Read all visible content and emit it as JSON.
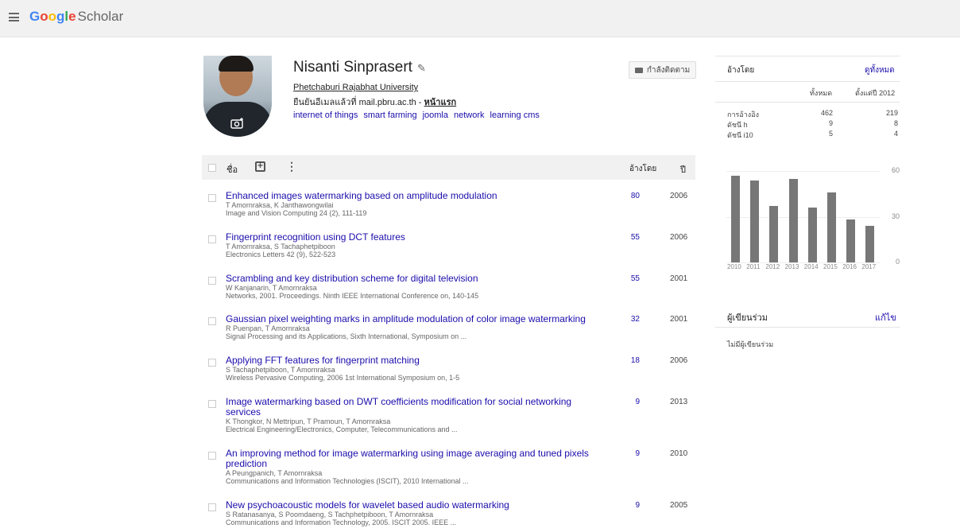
{
  "header": {
    "logo_word": "Google",
    "logo_colors": [
      "#4285F4",
      "#EA4335",
      "#FBBC05",
      "#4285F4",
      "#34A853",
      "#EA4335"
    ],
    "logo_suffix": "Scholar",
    "menu_icon": "hamburger-menu-icon"
  },
  "profile": {
    "name": "Nisanti Sinprasert",
    "affiliation": "Phetchaburi Rajabhat University",
    "verified_text": "ยืนยันอีเมลแล้วที่ mail.pbru.ac.th - ",
    "homepage_label": "หน้าแรก",
    "interests": [
      "internet of things",
      "smart farming",
      "joomla",
      "network",
      "learning cms"
    ],
    "follow_label": "กำลังติดตาม",
    "camera_icon": "camera-icon",
    "edit_icon": "pencil-icon"
  },
  "table": {
    "title_header": "ชื่อ",
    "cited_header": "อ้างโดย",
    "year_header": "ปี"
  },
  "articles": [
    {
      "title": "Enhanced images watermarking based on amplitude modulation",
      "authors": "T Amornraksa, K Janthawongwilai",
      "venue": "Image and Vision Computing 24 (2), 111-119",
      "cited": "80",
      "year": "2006"
    },
    {
      "title": "Fingerprint recognition using DCT features",
      "authors": "T Amornraksa, S Tachaphetpiboon",
      "venue": "Electronics Letters 42 (9), 522-523",
      "cited": "55",
      "year": "2006"
    },
    {
      "title": "Scrambling and key distribution scheme for digital television",
      "authors": "W Kanjanarin, T Amornraksa",
      "venue": "Networks, 2001. Proceedings. Ninth IEEE International Conference on, 140-145",
      "cited": "55",
      "year": "2001"
    },
    {
      "title": "Gaussian pixel weighting marks in amplitude modulation of color image watermarking",
      "authors": "R Puenpan, T Amornraksa",
      "venue": "Signal Processing and its Applications, Sixth International, Symposium on ...",
      "cited": "32",
      "year": "2001"
    },
    {
      "title": "Applying FFT features for fingerprint matching",
      "authors": "S Tachaphetpiboon, T Amornraksa",
      "venue": "Wireless Pervasive Computing, 2006 1st International Symposium on, 1-5",
      "cited": "18",
      "year": "2006"
    },
    {
      "title": "Image watermarking based on DWT coefficients modification for social networking services",
      "authors": "K Thongkor, N Mettripun, T Pramoun, T Amornraksa",
      "venue": "Electrical Engineering/Electronics, Computer, Telecommunications and ...",
      "cited": "9",
      "year": "2013"
    },
    {
      "title": "An improving method for image watermarking using image averaging and tuned pixels prediction",
      "authors": "A Peungpanich, T Amornraksa",
      "venue": "Communications and Information Technologies (ISCIT), 2010 International ...",
      "cited": "9",
      "year": "2010"
    },
    {
      "title": "New psychoacoustic models for wavelet based audio watermarking",
      "authors": "S Ratanasanya, S Poomdaeng, S Tachphetpiboon, T Amornraksa",
      "venue": "Communications and Information Technology, 2005. ISCIT 2005. IEEE ...",
      "cited": "9",
      "year": "2005"
    }
  ],
  "cited_by": {
    "title": "อ้างโดย",
    "view_all": "ดูทั้งหมด",
    "col_all": "ทั้งหมด",
    "col_since": "ตั้งแต่ปี 2012",
    "rows": [
      {
        "label": "การอ้างอิง",
        "all": "462",
        "since": "219"
      },
      {
        "label": "ดัชนี h",
        "all": "9",
        "since": "8"
      },
      {
        "label": "ดัชนี i10",
        "all": "5",
        "since": "4"
      }
    ]
  },
  "chart_data": {
    "type": "bar",
    "categories": [
      "2010",
      "2011",
      "2012",
      "2013",
      "2014",
      "2015",
      "2016",
      "2017"
    ],
    "values": [
      57,
      54,
      37,
      55,
      36,
      46,
      28,
      24
    ],
    "ylim": [
      0,
      60
    ],
    "yticks": [
      "60",
      "30",
      "0"
    ],
    "bar_color": "#777777"
  },
  "coauthors": {
    "title": "ผู้เขียนร่วม",
    "edit_label": "แก้ไข",
    "empty_text": "ไม่มีผู้เขียนร่วม"
  }
}
